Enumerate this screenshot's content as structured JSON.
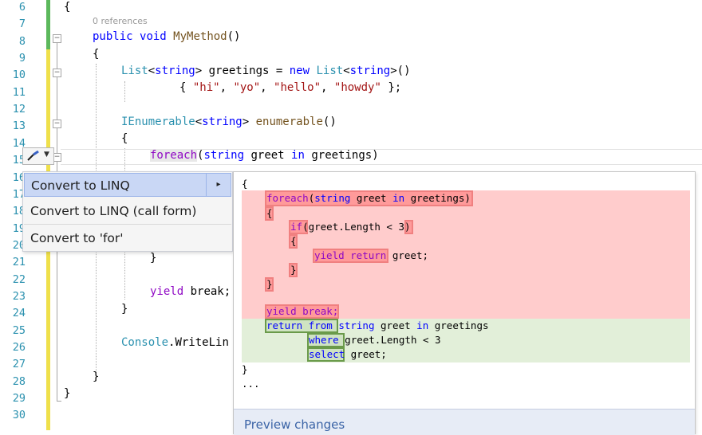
{
  "line_numbers": [
    "6",
    "7",
    "8",
    "9",
    "10",
    "11",
    "12",
    "13",
    "14",
    "15",
    "16",
    "17",
    "18",
    "19",
    "20",
    "21",
    "22",
    "23",
    "24",
    "25",
    "26",
    "27",
    "28",
    "29",
    "30"
  ],
  "codelens": "0 references",
  "code": {
    "l6": "{",
    "l7_kw1": "public",
    "l7_kw2": "void",
    "l7_name": "MyMethod",
    "l7_rest": "()",
    "l8": "{",
    "l9_ty1": "List",
    "l9_p1": "<",
    "l9_kw1": "string",
    "l9_p2": "> greetings = ",
    "l9_kw2": "new",
    "l9_ty2": "List",
    "l9_p3": "<",
    "l9_kw3": "string",
    "l9_p4": ">()",
    "l10_p1": "{ ",
    "l10_s1": "\"hi\"",
    "l10_c1": ", ",
    "l10_s2": "\"yo\"",
    "l10_c2": ", ",
    "l10_s3": "\"hello\"",
    "l10_c3": ", ",
    "l10_s4": "\"howdy\"",
    "l10_p2": " };",
    "l12_ty": "IEnumerable",
    "l12_p1": "<",
    "l12_kw": "string",
    "l12_p2": "> ",
    "l12_name": "enumerable",
    "l12_p3": "()",
    "l13": "{",
    "l14_ctl": "foreach",
    "l14_p1": "(",
    "l14_kw1": "string",
    "l14_p2": " greet ",
    "l14_kw2": "in",
    "l14_p3": " greetings)",
    "l20": "}",
    "l22_ctl": "yield",
    "l22_rest": " break;",
    "l23": "}",
    "l25_ty": "Console",
    "l25_rest": ".WriteLin",
    "l27": "}",
    "l28": "}"
  },
  "quick_actions_menu": {
    "items": [
      "Convert to LINQ",
      "Convert to LINQ (call form)",
      "Convert to 'for'"
    ],
    "submenu_arrow": "▸"
  },
  "preview": {
    "open_brace": "{",
    "foreach_kw": "foreach",
    "foreach_p": "(",
    "foreach_type": "string",
    "foreach_var": " greet ",
    "foreach_in": "in",
    "foreach_rest": " greetings)",
    "brace_open_1": "{",
    "if_kw": "if",
    "if_rest": "(greet.Length < 3)",
    "brace_open_2": "{",
    "yield_return": "yield return",
    "yield_rest": " greet;",
    "brace_close_2": "}",
    "brace_close_1": "}",
    "yield_break": "yield break;",
    "return_from": "return from",
    "rf_rest1": " ",
    "rf_type": "string",
    "rf_var": " greet ",
    "rf_in": "in",
    "rf_rest2": " greetings",
    "where_kw": "where",
    "where_rest": " greet.Length < 3",
    "select_kw": "select",
    "select_rest": " greet;",
    "close_brace": "}",
    "ellipsis": "...",
    "footer_link": "Preview changes"
  },
  "colors": {
    "keyword": "#0000ff",
    "type": "#2b91af",
    "string": "#a31515",
    "control": "#8f08c4",
    "removed_bg": "#ffcccc",
    "added_bg": "#e2efd9",
    "menu_selected": "#c9d7f5"
  }
}
